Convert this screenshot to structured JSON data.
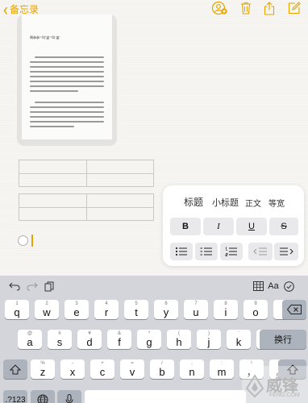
{
  "nav": {
    "back_label": "备忘录",
    "icons": [
      "add-person-icon",
      "trash-icon",
      "share-icon",
      "compose-icon"
    ]
  },
  "document": {
    "title": "啊恭恭\"\"叫\"盅\"\"叫\"盅\""
  },
  "format_menu": {
    "styles": [
      "标题",
      "小标题",
      "正文",
      "等宽"
    ],
    "bold": "B",
    "italic": "I",
    "underline": "U",
    "strike": "S"
  },
  "keyboard": {
    "row1": [
      {
        "num": "1",
        "ch": "q"
      },
      {
        "num": "2",
        "ch": "w"
      },
      {
        "num": "3",
        "ch": "e"
      },
      {
        "num": "4",
        "ch": "r"
      },
      {
        "num": "5",
        "ch": "t"
      },
      {
        "num": "6",
        "ch": "y"
      },
      {
        "num": "7",
        "ch": "u"
      },
      {
        "num": "8",
        "ch": "i"
      },
      {
        "num": "9",
        "ch": "o"
      },
      {
        "num": "0",
        "ch": "p"
      }
    ],
    "row2": [
      {
        "num": "@",
        "ch": "a"
      },
      {
        "num": "#",
        "ch": "s"
      },
      {
        "num": "¥",
        "ch": "d"
      },
      {
        "num": "&",
        "ch": "f"
      },
      {
        "num": "*",
        "ch": "g"
      },
      {
        "num": "(",
        "ch": "h"
      },
      {
        "num": ")",
        "ch": "j"
      },
      {
        "num": "'",
        "ch": "k"
      },
      {
        "num": "\"",
        "ch": "l"
      }
    ],
    "row3": [
      {
        "num": "%",
        "ch": "z"
      },
      {
        "num": "-",
        "ch": "x"
      },
      {
        "num": "+",
        "ch": "c"
      },
      {
        "num": "=",
        "ch": "v"
      },
      {
        "num": "/",
        "ch": "b"
      },
      {
        "num": ";",
        "ch": "n"
      },
      {
        "num": ":",
        "ch": "m"
      },
      {
        "num": "!",
        "ch": "，"
      },
      {
        "num": "?",
        "ch": "。"
      }
    ],
    "return_label": "换行",
    "numbers_label": ".?123",
    "toolbar_text_format": "Aa"
  },
  "watermark": {
    "cn": "威锋",
    "en": "FENG.COM"
  },
  "colors": {
    "accent": "#e3a400",
    "keyboard_bg": "#d3d5db",
    "key_gray": "#adb3bc"
  }
}
